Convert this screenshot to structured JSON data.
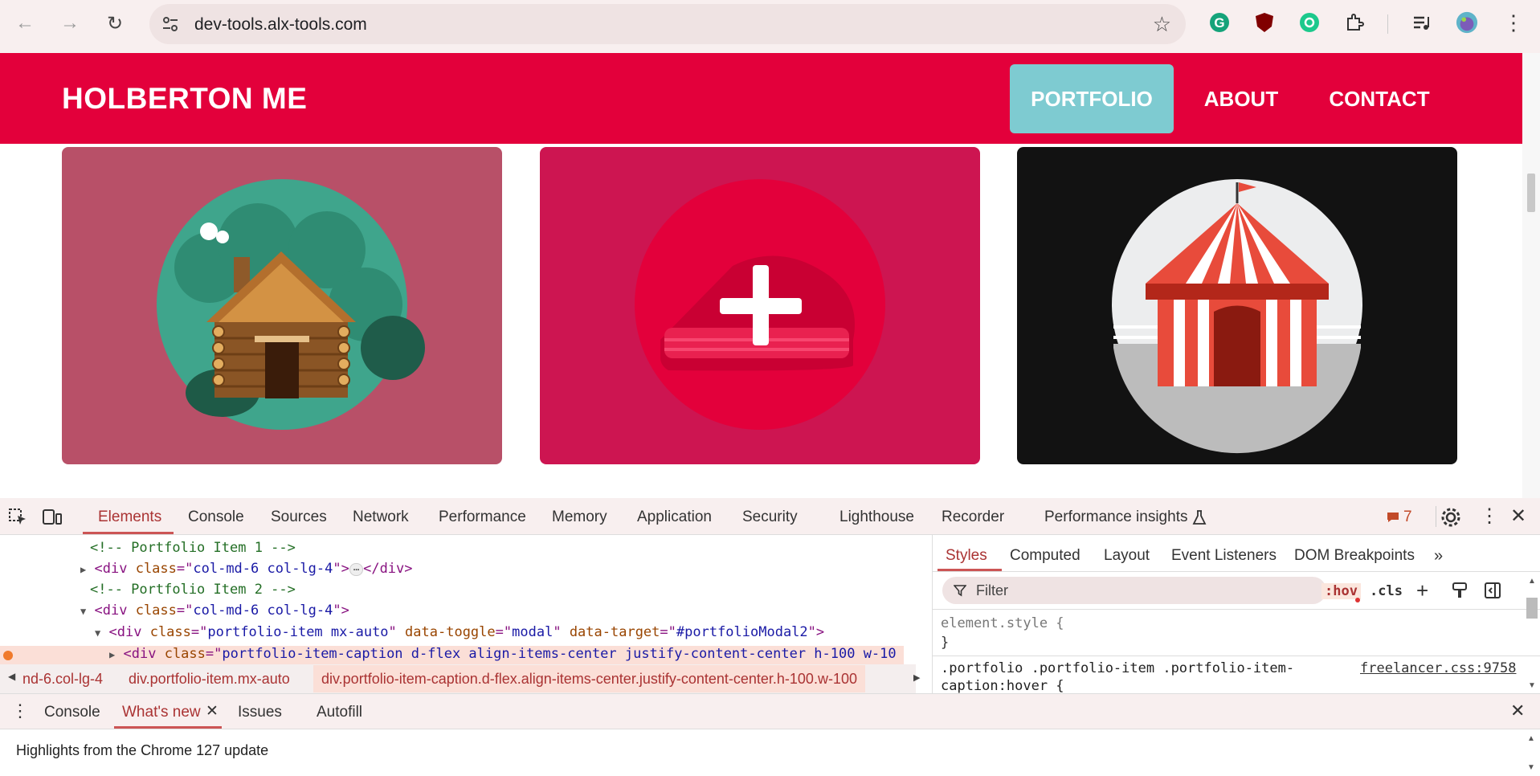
{
  "browser": {
    "url": "dev-tools.alx-tools.com",
    "nav_icons": [
      "back-icon",
      "forward-icon",
      "reload-icon"
    ],
    "extension_icons": [
      "grammarly-icon",
      "ublock-icon",
      "sync-extension-icon",
      "extensions-puzzle-icon",
      "media-queue-icon",
      "profile-avatar-icon",
      "menu-kebab-icon"
    ]
  },
  "site": {
    "brand": "HOLBERTON ME",
    "nav": [
      {
        "label": "PORTFOLIO",
        "active": true
      },
      {
        "label": "ABOUT",
        "active": false
      },
      {
        "label": "CONTACT",
        "active": false
      }
    ],
    "cards": [
      {
        "image": "log-cabin-illustration",
        "bg": "#b85068"
      },
      {
        "image": "cake-illustration-hover",
        "bg": "#df0f49"
      },
      {
        "image": "circus-tent-illustration",
        "bg": "#121212"
      }
    ],
    "brand_color": "#e3003b",
    "active_nav_color": "#7ecbd1"
  },
  "devtools": {
    "tabs": [
      "Elements",
      "Console",
      "Sources",
      "Network",
      "Performance",
      "Memory",
      "Application",
      "Security",
      "Lighthouse",
      "Recorder",
      "Performance insights"
    ],
    "selected_tab": "Elements",
    "issue_count": "7",
    "dom_lines": [
      {
        "comment": "<!-- Portfolio Item 1 -->"
      },
      {
        "tag": "div",
        "attr": "class",
        "val": "col-md-6 col-lg-4",
        "collapsed": true
      },
      {
        "comment": "<!-- Portfolio Item 2 -->"
      },
      {
        "tag": "div",
        "attr": "class",
        "val": "col-md-6 col-lg-4"
      },
      {
        "tag": "div",
        "attr": "class",
        "val": "portfolio-item mx-auto",
        "attr2": "data-toggle",
        "val2": "modal",
        "attr3": "data-target",
        "val3": "#portfolioModal2"
      },
      {
        "tag": "div",
        "attr": "class",
        "val": "portfolio-item-caption d-flex align-items-center justify-content-center h-100 w-10"
      }
    ],
    "breadcrumbs": [
      "nd-6.col-lg-4",
      "div.portfolio-item.mx-auto",
      "div.portfolio-item-caption.d-flex.align-items-center.justify-content-center.h-100.w-100"
    ],
    "styles_tabs": [
      "Styles",
      "Computed",
      "Layout",
      "Event Listeners",
      "DOM Breakpoints"
    ],
    "filter_placeholder": "Filter",
    "hov": ":hov",
    "cls": ".cls",
    "element_style_open": "element.style {",
    "element_style_close": "}",
    "rule_selector_1": ".portfolio .portfolio-item .portfolio-item-",
    "rule_selector_2": "caption:hover {",
    "rule_source": "freelancer.css:9758",
    "drawer_tabs": [
      "Console",
      "What's new",
      "Issues",
      "Autofill"
    ],
    "drawer_selected": "What's new",
    "drawer_text": "Highlights from the Chrome 127 update"
  }
}
